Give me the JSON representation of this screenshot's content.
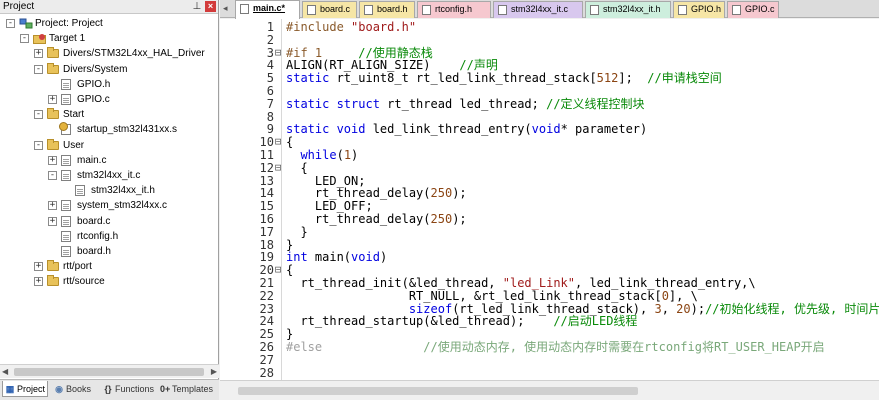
{
  "project_pane": {
    "title": "Project",
    "pin_glyph": "⊥",
    "close_glyph": "×",
    "tree": [
      {
        "label": "Project: Project",
        "depth": 0,
        "toggle": "-",
        "icon": "project-icon"
      },
      {
        "label": "Target 1",
        "depth": 1,
        "toggle": "-",
        "icon": "target-icon"
      },
      {
        "label": "Divers/STM32L4xx_HAL_Driver",
        "depth": 2,
        "toggle": "+",
        "icon": "folder-icon"
      },
      {
        "label": "Divers/System",
        "depth": 2,
        "toggle": "-",
        "icon": "folder-icon"
      },
      {
        "label": "GPIO.h",
        "depth": 3,
        "toggle": "",
        "icon": "file-icon"
      },
      {
        "label": "GPIO.c",
        "depth": 3,
        "toggle": "+",
        "icon": "file-icon"
      },
      {
        "label": "Start",
        "depth": 2,
        "toggle": "-",
        "icon": "folder-icon"
      },
      {
        "label": "startup_stm32l431xx.s",
        "depth": 3,
        "toggle": "",
        "icon": "asm-file-icon"
      },
      {
        "label": "User",
        "depth": 2,
        "toggle": "-",
        "icon": "folder-icon"
      },
      {
        "label": "main.c",
        "depth": 3,
        "toggle": "+",
        "icon": "file-icon"
      },
      {
        "label": "stm32l4xx_it.c",
        "depth": 3,
        "toggle": "-",
        "icon": "file-icon"
      },
      {
        "label": "stm32l4xx_it.h",
        "depth": 4,
        "toggle": "",
        "icon": "file-icon"
      },
      {
        "label": "system_stm32l4xx.c",
        "depth": 3,
        "toggle": "+",
        "icon": "file-icon"
      },
      {
        "label": "board.c",
        "depth": 3,
        "toggle": "+",
        "icon": "file-icon"
      },
      {
        "label": "rtconfig.h",
        "depth": 3,
        "toggle": "",
        "icon": "file-icon"
      },
      {
        "label": "board.h",
        "depth": 3,
        "toggle": "",
        "icon": "file-icon"
      },
      {
        "label": "rtt/port",
        "depth": 2,
        "toggle": "+",
        "icon": "folder-icon"
      },
      {
        "label": "rtt/source",
        "depth": 2,
        "toggle": "+",
        "icon": "folder-icon"
      }
    ],
    "bottom_tabs": [
      {
        "label": "Project",
        "icon": "project-tab-icon",
        "glyph": "▦"
      },
      {
        "label": "Books",
        "icon": "books-icon",
        "glyph": "◉"
      },
      {
        "label": "Functions",
        "icon": "functions-icon",
        "glyph": "{}"
      },
      {
        "label": "Templates",
        "icon": "templates-icon",
        "glyph": "0+"
      }
    ]
  },
  "editor_tabs": [
    {
      "label": "main.c*",
      "color": "#ffffff",
      "active": true
    },
    {
      "label": "board.c",
      "color": "#f6e6a6",
      "active": false
    },
    {
      "label": "board.h",
      "color": "#f6e6a6",
      "active": false
    },
    {
      "label": "rtconfig.h",
      "color": "#f6c8cf",
      "active": false
    },
    {
      "label": "stm32l4xx_it.c",
      "color": "#d8c8ee",
      "active": false
    },
    {
      "label": "stm32l4xx_it.h",
      "color": "#cdeedd",
      "active": false
    },
    {
      "label": "GPIO.h",
      "color": "#f6e6a6",
      "active": false
    },
    {
      "label": "GPIO.c",
      "color": "#f6c8cf",
      "active": false
    }
  ],
  "code_lines": [
    {
      "n": "1",
      "fold": "",
      "t": [
        [
          "pp",
          "#include "
        ],
        [
          "str",
          "\"board.h\""
        ]
      ]
    },
    {
      "n": "2",
      "fold": "",
      "t": []
    },
    {
      "n": "3",
      "fold": "⊟",
      "t": [
        [
          "pp",
          "#if 1"
        ],
        [
          "",
          "     "
        ],
        [
          "cm",
          "//使用静态栈"
        ]
      ]
    },
    {
      "n": "4",
      "fold": "",
      "t": [
        [
          "",
          "ALIGN(RT_ALIGN_SIZE)    "
        ],
        [
          "cm",
          "//声明"
        ]
      ]
    },
    {
      "n": "5",
      "fold": "",
      "t": [
        [
          "kw",
          "static"
        ],
        [
          "",
          " rt_uint8_t rt_led_link_thread_stack["
        ],
        [
          "num",
          "512"
        ],
        [
          "",
          "];  "
        ],
        [
          "cm",
          "//申请栈空间"
        ]
      ]
    },
    {
      "n": "6",
      "fold": "",
      "t": []
    },
    {
      "n": "7",
      "fold": "",
      "t": [
        [
          "kw",
          "static struct"
        ],
        [
          "",
          " rt_thread led_thread; "
        ],
        [
          "cm",
          "//定义线程控制块"
        ]
      ]
    },
    {
      "n": "8",
      "fold": "",
      "t": []
    },
    {
      "n": "9",
      "fold": "",
      "t": [
        [
          "kw",
          "static void"
        ],
        [
          "",
          " led_link_thread_entry("
        ],
        [
          "kw",
          "void"
        ],
        [
          "",
          "* parameter)"
        ]
      ]
    },
    {
      "n": "10",
      "fold": "⊟",
      "t": [
        [
          "",
          "{"
        ]
      ]
    },
    {
      "n": "11",
      "fold": "",
      "t": [
        [
          "",
          "  "
        ],
        [
          "kw",
          "while"
        ],
        [
          "",
          "("
        ],
        [
          "num",
          "1"
        ],
        [
          "",
          ")"
        ]
      ]
    },
    {
      "n": "12",
      "fold": "⊟",
      "t": [
        [
          "",
          "  {"
        ]
      ]
    },
    {
      "n": "13",
      "fold": "",
      "t": [
        [
          "",
          "    LED_ON;"
        ]
      ]
    },
    {
      "n": "14",
      "fold": "",
      "t": [
        [
          "",
          "    rt_thread_delay("
        ],
        [
          "num",
          "250"
        ],
        [
          "",
          ");"
        ]
      ]
    },
    {
      "n": "15",
      "fold": "",
      "t": [
        [
          "",
          "    LED_OFF;"
        ]
      ]
    },
    {
      "n": "16",
      "fold": "",
      "t": [
        [
          "",
          "    rt_thread_delay("
        ],
        [
          "num",
          "250"
        ],
        [
          "",
          ");"
        ]
      ]
    },
    {
      "n": "17",
      "fold": "",
      "t": [
        [
          "",
          "  }"
        ]
      ]
    },
    {
      "n": "18",
      "fold": "",
      "t": [
        [
          "",
          "}"
        ]
      ]
    },
    {
      "n": "19",
      "fold": "",
      "t": [
        [
          "kw",
          "int"
        ],
        [
          "",
          " main("
        ],
        [
          "kw",
          "void"
        ],
        [
          "",
          ")"
        ]
      ]
    },
    {
      "n": "20",
      "fold": "⊟",
      "t": [
        [
          "",
          "{"
        ]
      ]
    },
    {
      "n": "21",
      "fold": "",
      "t": [
        [
          "",
          "  rt_thread_init(&led_thread, "
        ],
        [
          "str",
          "\"led_Link\""
        ],
        [
          "",
          ", led_link_thread_entry,\\"
        ]
      ]
    },
    {
      "n": "22",
      "fold": "",
      "t": [
        [
          "",
          "                 RT_NULL, &rt_led_link_thread_stack["
        ],
        [
          "num",
          "0"
        ],
        [
          "",
          "], \\"
        ]
      ]
    },
    {
      "n": "23",
      "fold": "",
      "t": [
        [
          "",
          "                 "
        ],
        [
          "kw",
          "sizeof"
        ],
        [
          "",
          "(rt_led_link_thread_stack), "
        ],
        [
          "num",
          "3"
        ],
        [
          "",
          ", "
        ],
        [
          "num",
          "20"
        ],
        [
          "",
          ");"
        ],
        [
          "cm",
          "//初始化线程, 优先级, 时间片"
        ]
      ]
    },
    {
      "n": "24",
      "fold": "",
      "t": [
        [
          "",
          "  rt_thread_startup(&led_thread);    "
        ],
        [
          "cm",
          "//启动LED线程"
        ]
      ]
    },
    {
      "n": "25",
      "fold": "",
      "t": [
        [
          "",
          "}"
        ]
      ]
    },
    {
      "n": "26",
      "fold": "",
      "t": [
        [
          "pp-dim",
          "#else"
        ],
        [
          "",
          "              "
        ],
        [
          "cm-dim",
          "//使用动态内存, 使用动态内存时需要在rtconfig将RT_USER_HEAP开启"
        ]
      ]
    },
    {
      "n": "27",
      "fold": "",
      "t": []
    },
    {
      "n": "28",
      "fold": "",
      "t": []
    }
  ]
}
